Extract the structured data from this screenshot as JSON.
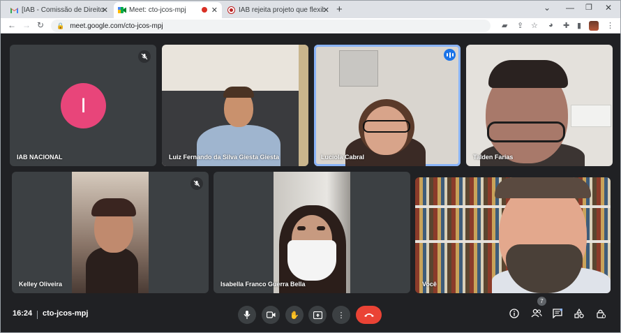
{
  "browser": {
    "tabs": [
      {
        "title": "[IAB - Comissão de Direito Amb",
        "icon": "gmail-icon"
      },
      {
        "title": "Meet: cto-jcos-mpj",
        "icon": "meet-icon",
        "active": true
      },
      {
        "title": "IAB rejeita projeto que flexibiliza",
        "icon": "iab-icon"
      }
    ],
    "close_glyph": "✕",
    "newtab_glyph": "+",
    "url": "meet.google.com/cto-jcos-mpj"
  },
  "meet": {
    "participants": [
      {
        "name": "IAB NACIONAL",
        "initial": "I",
        "muted": true
      },
      {
        "name": "Luiz Fernando da Silva Giesta Giesta"
      },
      {
        "name": "Luciola Cabral",
        "speaking": true
      },
      {
        "name": "Talden Farias"
      },
      {
        "name": "Kelley Oliveira",
        "muted": true
      },
      {
        "name": "Isabella Franco Guerra Bella"
      },
      {
        "name": "Você"
      }
    ],
    "bottom": {
      "time": "16:24",
      "meeting_code": "cto-jcos-mpj",
      "people_count": "7"
    }
  },
  "colors": {
    "avatar": "#e8457a",
    "end_call": "#ea4335",
    "speaking": "#1a73e8"
  }
}
